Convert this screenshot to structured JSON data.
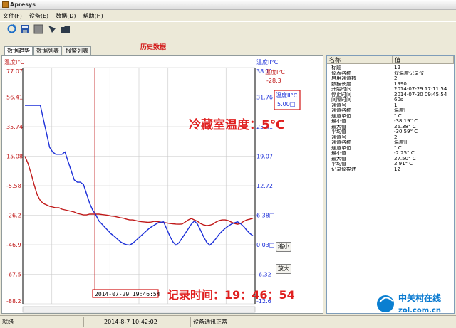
{
  "window": {
    "title": "Apresys"
  },
  "menu": [
    "文件(F)",
    "设备(E)",
    "数据(D)",
    "帮助(H)"
  ],
  "toolbar": {
    "icons": [
      "refresh-icon",
      "save-icon",
      "gray-square-icon",
      "export-icon",
      "folder-icon"
    ]
  },
  "title_red": "历史数据",
  "tabs": [
    {
      "label": "数据趋势",
      "active": true
    },
    {
      "label": "数据列表"
    },
    {
      "label": "报警列表"
    }
  ],
  "chart_axes": {
    "left_title": "温度I°C",
    "right_title": "温度II°C",
    "left_ticks": [
      "77.07",
      "56.41",
      "35.74",
      "15.08",
      "-5.58",
      "-26.2",
      "-46.9",
      "-67.5",
      "-88.2"
    ],
    "right_ticks": [
      "38.11",
      "31.76",
      "25.41",
      "19.07",
      "12.72",
      "6.38□",
      "0.03□",
      "-6.32",
      "-12.6"
    ]
  },
  "readouts": {
    "ch1_label": "温度I°C",
    "ch1_value": "-28.3",
    "ch2_label": "温度II°C",
    "ch2_value": "5.00□"
  },
  "buttons": {
    "zoom_out": "缩小",
    "zoom_in": "放大"
  },
  "cursor_time": "2014-07-29 19:46:54",
  "annotations": {
    "fridge_temp": "冷藏室温度：5℃",
    "record_time": "记录时间：19：46：54"
  },
  "properties": {
    "header": {
      "name": "名称",
      "value": "值"
    },
    "rows": [
      [
        "标题",
        "12"
      ],
      [
        "仪表名称",
        "双温度记录仪"
      ],
      [
        "启用通道数",
        "2"
      ],
      [
        "数据长度",
        "1990"
      ],
      [
        "开始时间",
        "2014-07-29 17:11:54"
      ],
      [
        "停止时间",
        "2014-07-30 09:45:54"
      ],
      [
        "间隔时间",
        "60s"
      ],
      [
        "通道号",
        "1"
      ],
      [
        "通道名称",
        "温度I"
      ],
      [
        "通道单位",
        "° C"
      ],
      [
        "最小值",
        "-38.19° C"
      ],
      [
        "最大值",
        "26.38° C"
      ],
      [
        "平均值",
        "-30.59° C"
      ],
      [
        "通道号",
        "2"
      ],
      [
        "通道名称",
        "温度II"
      ],
      [
        "通道单位",
        "° C"
      ],
      [
        "最小值",
        "-2.25° C"
      ],
      [
        "最大值",
        "27.50° C"
      ],
      [
        "平均值",
        "2.91° C"
      ],
      [
        "记录仪描述",
        "12"
      ]
    ]
  },
  "status": {
    "left": "就绪",
    "datetime": "2014-8-7 10:42:02",
    "comm": "设备通讯正常"
  },
  "watermark": {
    "brand": "中关村在线",
    "domain": "zol.com.cn"
  },
  "colors": {
    "ch1": "#c01818",
    "ch2": "#1c2fd8",
    "annot": "#e02020"
  },
  "chart_data": {
    "type": "line",
    "xlabel": "",
    "series": [
      {
        "name": "温度I°C",
        "axis": "left",
        "values": [
          15,
          10,
          3,
          -5,
          -12,
          -16,
          -18,
          -19,
          -20,
          -20.5,
          -21,
          -21,
          -22,
          -22.5,
          -23,
          -23.5,
          -24,
          -25,
          -25.5,
          -26,
          -26,
          -25.5,
          -25.5,
          -25.5,
          -25.5,
          -25.8,
          -26,
          -26.3,
          -26.8,
          -27,
          -27.5,
          -28,
          -28.3,
          -29,
          -29.5,
          -29.5,
          -30,
          -30.5,
          -30.8,
          -31,
          -31.2,
          -31,
          -30.5,
          -30.7,
          -31,
          -31.3,
          -31.6,
          -32,
          -32.2,
          -32.4,
          -32.5,
          -32.4,
          -31,
          -29.5,
          -28.5,
          -29.5,
          -30.5,
          -32,
          -33,
          -33.5,
          -33.2,
          -32.5,
          -31,
          -30,
          -29.5,
          -29.5,
          -30,
          -31,
          -32,
          -32.5,
          -32,
          -30.5,
          -29.5,
          -29,
          -28.3
        ]
      },
      {
        "name": "温度II°C",
        "axis": "right",
        "values": [
          30,
          30,
          30,
          30,
          30,
          30,
          27,
          24,
          21,
          20,
          19.5,
          19.5,
          19.5,
          20,
          18,
          16,
          14,
          13.5,
          13.5,
          13,
          11,
          9,
          7.5,
          6.5,
          5.2,
          4.5,
          3.8,
          3.1,
          2.4,
          1.9,
          1.3,
          0.7,
          0.3,
          0.1,
          0,
          0.4,
          1,
          1.6,
          2.2,
          2.8,
          3.4,
          3.9,
          4.3,
          4.7,
          4.9,
          5,
          3.5,
          2,
          0.7,
          0,
          0.5,
          1.5,
          2.5,
          3.5,
          4.5,
          5.2,
          4.5,
          3.2,
          1.8,
          0.6,
          0,
          0.6,
          1.4,
          2.3,
          3,
          3.6,
          4.1,
          4.5,
          4.8,
          5,
          4.6,
          4,
          3.2,
          2.5,
          2
        ]
      }
    ],
    "ylim_left": [
      -88.2,
      77.07
    ],
    "ylim_right": [
      -12.6,
      38.11
    ],
    "grid": true
  }
}
